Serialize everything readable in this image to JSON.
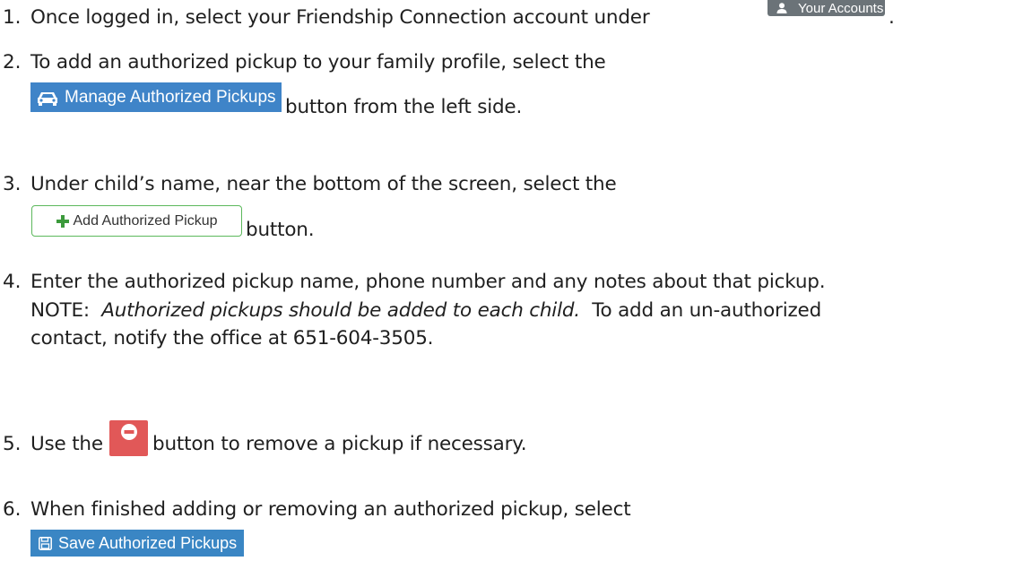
{
  "steps": [
    {
      "number": "1.",
      "before": "Once logged in, select your Friendship Connection account under",
      "after": ".",
      "button": {
        "label": "Your Accounts",
        "icon": "user-icon",
        "color": "#6b7378"
      }
    },
    {
      "number": "2.",
      "line1": "To add an authorized pickup to your family profile, select the",
      "after": "button from the left side.",
      "button": {
        "label": "Manage Authorized Pickups",
        "icon": "car-icon",
        "color": "#3f84c8"
      }
    },
    {
      "number": "3.",
      "line1": "Under child’s name, near the bottom of the screen, select the",
      "after": "button.",
      "button": {
        "label": "Add Authorized Pickup",
        "icon": "plus-icon",
        "border_color": "#5cb85c",
        "icon_color": "#3c9a3c"
      }
    },
    {
      "number": "4.",
      "line1": "Enter the authorized pickup name, phone number and any notes about that pickup.",
      "note_label": "NOTE:",
      "note_italic": "Authorized pickups should be added to each child.",
      "note_rest": "To add an un-authorized",
      "line3": "contact, notify the office at 651-604-3505."
    },
    {
      "number": "5.",
      "before": "Use the",
      "after": "button to remove a pickup if necessary.",
      "button": {
        "icon": "minus-circle-icon",
        "color": "#e15858"
      }
    },
    {
      "number": "6.",
      "line1": "When finished adding or removing an authorized pickup, select",
      "button": {
        "label": "Save Authorized Pickups",
        "icon": "save-icon",
        "color": "#3a86c4"
      }
    }
  ]
}
